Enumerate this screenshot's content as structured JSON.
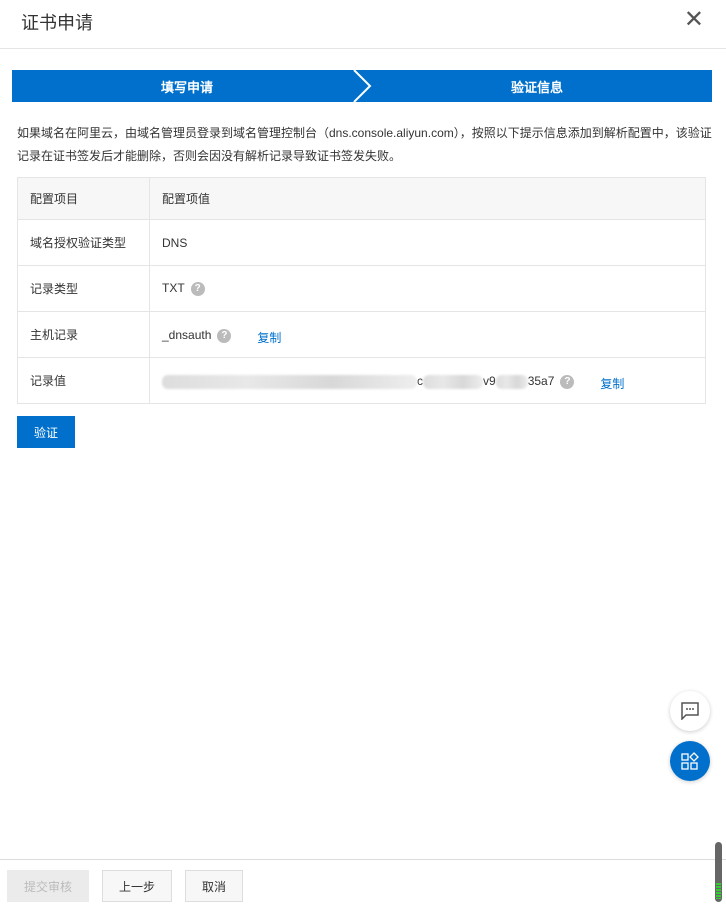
{
  "dialog": {
    "title": "证书申请",
    "close_icon": "close-icon"
  },
  "steps": [
    "填写申请",
    "验证信息"
  ],
  "note": "如果域名在阿里云，由域名管理员登录到域名管理控制台（dns.console.aliyun.com），按照以下提示信息添加到解析配置中，该验证记录在证书签发后才能删除，否则会因没有解析记录导致证书签发失败。",
  "table": {
    "headers": [
      "配置项目",
      "配置项值"
    ],
    "rows": [
      {
        "key": "域名授权验证类型",
        "value": "DNS"
      },
      {
        "key": "记录类型",
        "value": "TXT",
        "help": "?"
      },
      {
        "key": "主机记录",
        "value": "_dnsauth",
        "help": "?",
        "copy": "复制"
      },
      {
        "key": "记录值",
        "value_parts": [
          "c",
          "v9",
          "35a7"
        ],
        "help": "?",
        "copy": "复制"
      }
    ]
  },
  "verify_label": "验证",
  "footer": {
    "submit": "提交审核",
    "prev": "上一步",
    "cancel": "取消"
  }
}
